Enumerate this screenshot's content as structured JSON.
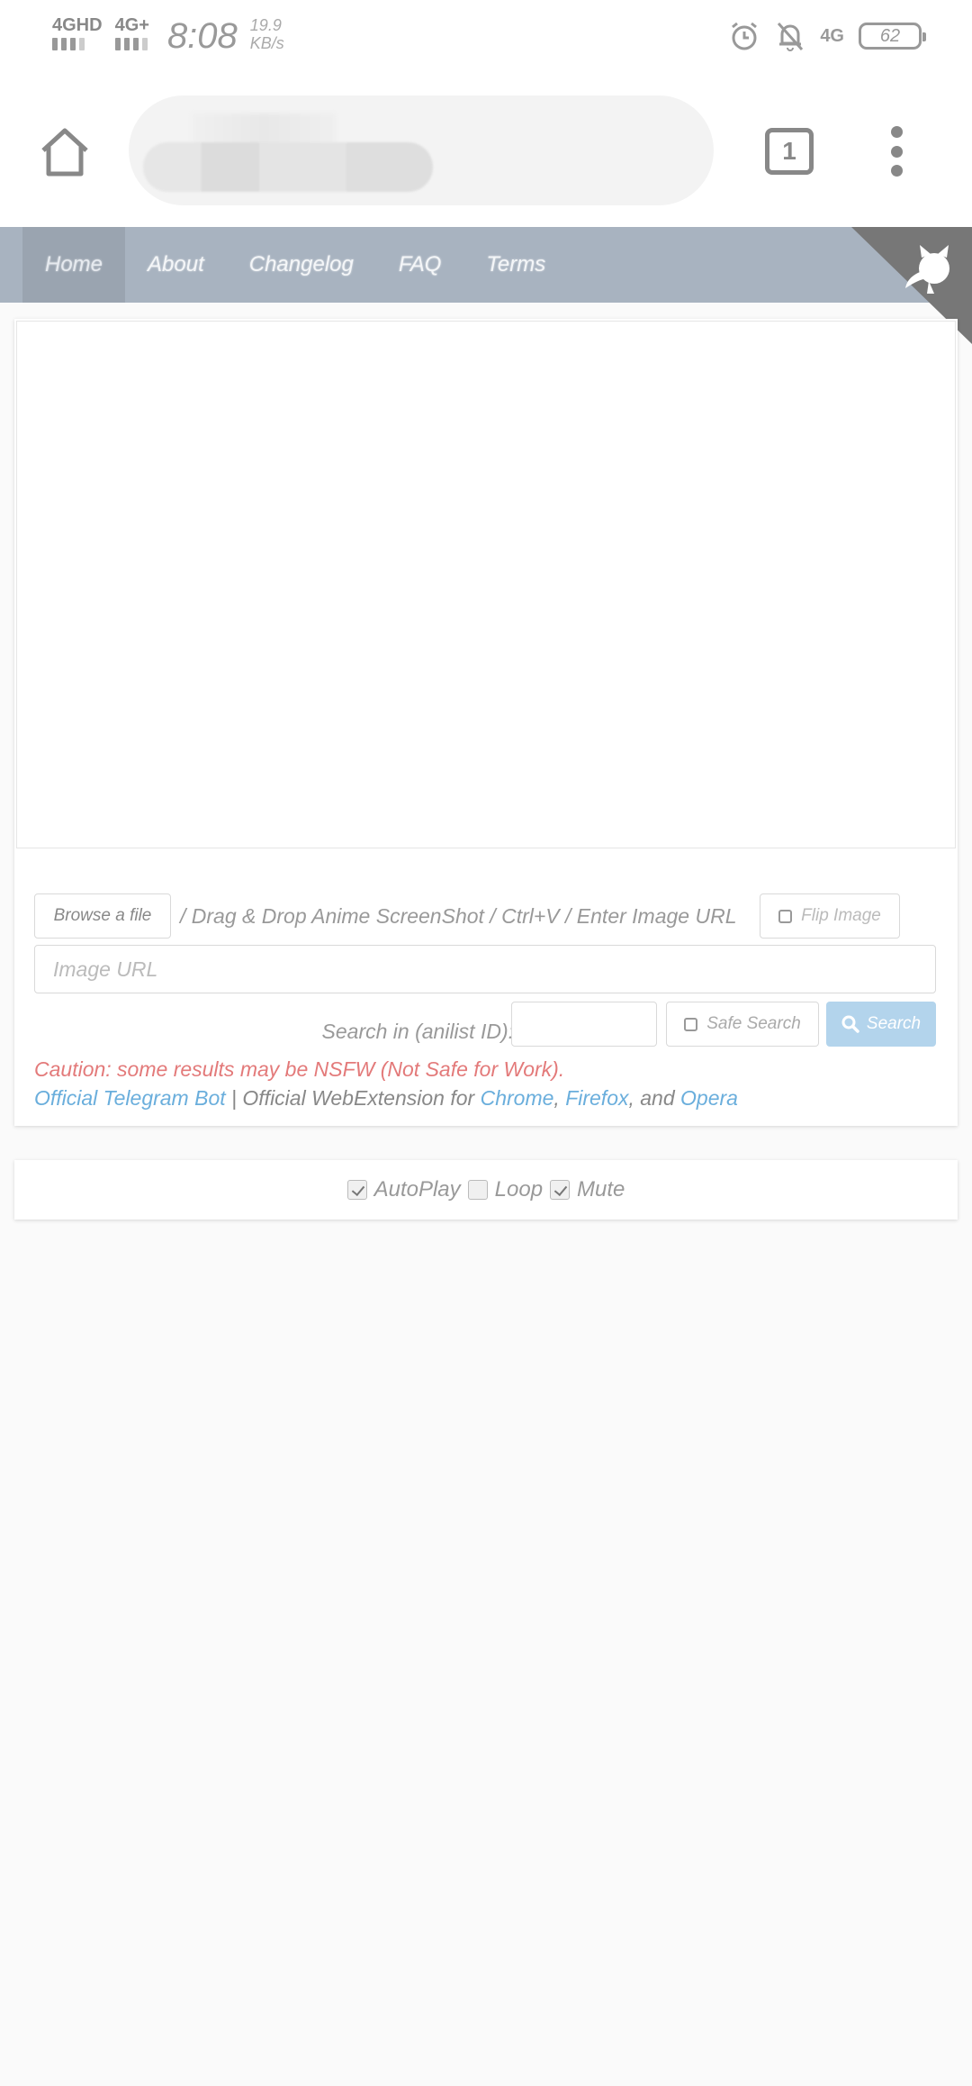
{
  "status_bar": {
    "network1": "4GHD",
    "network2": "4G+",
    "time": "8:08",
    "speed_value": "19.9",
    "speed_unit": "KB/s",
    "network3": "4G",
    "battery": "62"
  },
  "browser": {
    "tab_count": "1"
  },
  "nav": {
    "items": [
      {
        "label": "Home",
        "active": true
      },
      {
        "label": "About",
        "active": false
      },
      {
        "label": "Changelog",
        "active": false
      },
      {
        "label": "FAQ",
        "active": false
      },
      {
        "label": "Terms",
        "active": false
      }
    ]
  },
  "upload": {
    "browse_label": "Browse a file",
    "instructions": "/ Drag & Drop Anime ScreenShot / Ctrl+V / Enter Image URL",
    "flip_label": "Flip Image",
    "url_placeholder": "Image URL"
  },
  "search": {
    "anilist_label": "Search in (anilist ID):",
    "anilist_value": "",
    "safe_search_label": "Safe Search",
    "button_label": "Search"
  },
  "caution": "Caution: some results may be NSFW (Not Safe for Work).",
  "links": {
    "telegram": "Official Telegram Bot",
    "separator": " | Official WebExtension for ",
    "chrome": "Chrome",
    "comma": ", ",
    "firefox": "Firefox",
    "and": ", and ",
    "opera": "Opera"
  },
  "player_options": [
    {
      "label": "AutoPlay",
      "checked": true
    },
    {
      "label": "Loop",
      "checked": false
    },
    {
      "label": "Mute",
      "checked": true
    }
  ]
}
